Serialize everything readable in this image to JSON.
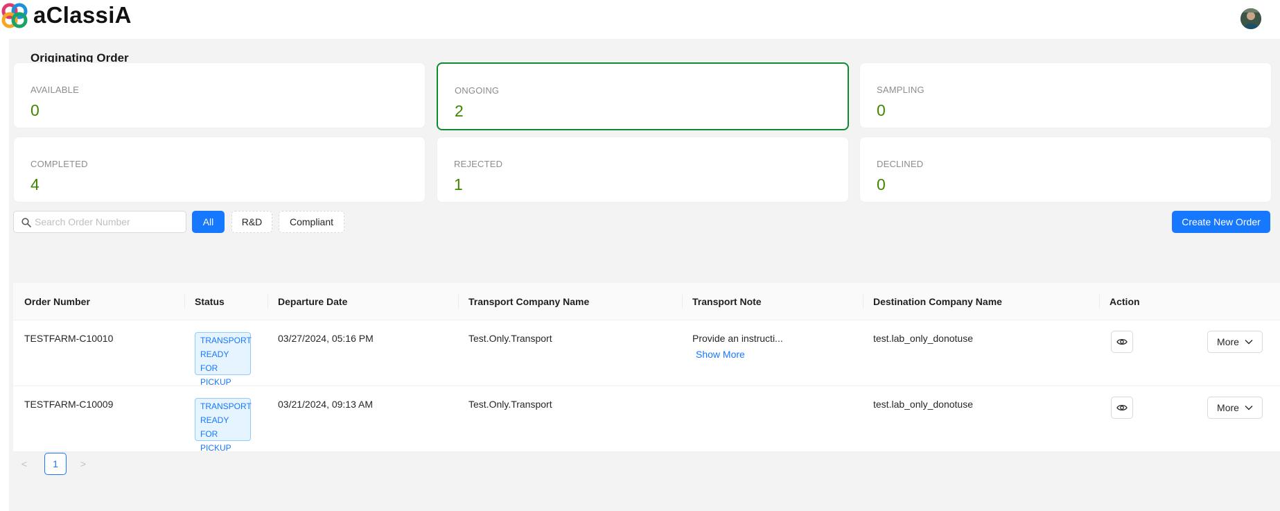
{
  "app": {
    "brand": "aClassiA"
  },
  "page": {
    "title": "Originating Order"
  },
  "stats": [
    {
      "label": "AVAILABLE",
      "value": "0"
    },
    {
      "label": "ONGOING",
      "value": "2"
    },
    {
      "label": "SAMPLING",
      "value": "0"
    },
    {
      "label": "COMPLETED",
      "value": "4"
    },
    {
      "label": "REJECTED",
      "value": "1"
    },
    {
      "label": "DECLINED",
      "value": "0"
    }
  ],
  "toolbar": {
    "search_placeholder": "Search Order Number",
    "filters": [
      "All",
      "R&D",
      "Compliant"
    ],
    "create_label": "Create New Order"
  },
  "table": {
    "columns": [
      "Order Number",
      "Status",
      "Departure Date",
      "Transport Company Name",
      "Transport Note",
      "Destination Company Name",
      "Action"
    ],
    "rows": [
      {
        "order_number": "TESTFARM-C10010",
        "status": "TRANSPORT READY FOR PICKUP",
        "departure_date": "03/27/2024, 05:16 PM",
        "transport_company": "Test.Only.Transport",
        "transport_note": "Provide an instructi...",
        "show_more": "Show More",
        "destination_company": "test.lab_only_donotuse",
        "more_label": "More"
      },
      {
        "order_number": "TESTFARM-C10009",
        "status": "TRANSPORT READY FOR PICKUP",
        "departure_date": "03/21/2024, 09:13 AM",
        "transport_company": "Test.Only.Transport",
        "transport_note": "",
        "show_more": "",
        "destination_company": "test.lab_only_donotuse",
        "more_label": "More"
      }
    ]
  },
  "pagination": {
    "current_page": "1",
    "prev": "<",
    "next": ">"
  },
  "colors": {
    "primary": "#1677ff",
    "stat_value": "#3f8600",
    "active_border": "#0b8a2f"
  }
}
